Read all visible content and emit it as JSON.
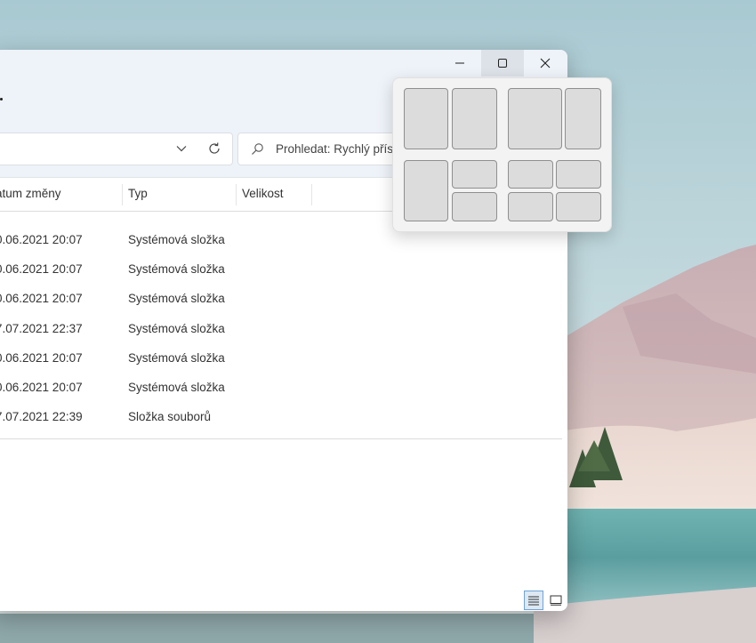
{
  "window": {
    "caption_buttons": {
      "minimize_icon": "minimize-icon",
      "maximize_icon": "maximize-icon",
      "close_icon": "close-icon"
    }
  },
  "toolbar": {
    "address_icons": [
      "chevron-down-icon",
      "refresh-icon"
    ],
    "search_placeholder": "Prohledat: Rychlý přístup"
  },
  "columns": {
    "date_modified": "atum změny",
    "type": "Typ",
    "size": "Velikost"
  },
  "rows": [
    {
      "date": "0.06.2021 20:07",
      "type": "Systémová složka"
    },
    {
      "date": "0.06.2021 20:07",
      "type": "Systémová složka"
    },
    {
      "date": "0.06.2021 20:07",
      "type": "Systémová složka"
    },
    {
      "date": "7.07.2021 22:37",
      "type": "Systémová složka"
    },
    {
      "date": "0.06.2021 20:07",
      "type": "Systémová složka"
    },
    {
      "date": "0.06.2021 20:07",
      "type": "Systémová složka"
    },
    {
      "date": "7.07.2021 22:39",
      "type": "Složka souborů"
    }
  ],
  "status_bar": {
    "view_buttons": [
      "details-view-icon",
      "tiles-view-icon"
    ],
    "active_view": "details"
  },
  "snap_layouts": [
    {
      "name": "two-equal-columns",
      "zones": 2
    },
    {
      "name": "wide-left-narrow-right",
      "zones": 2
    },
    {
      "name": "left-column-two-right-stacked",
      "zones": 3
    },
    {
      "name": "four-quadrants",
      "zones": 4
    }
  ],
  "colors": {
    "accent": "#6fa3d6",
    "titlebar": "#eef3f9",
    "snap_zone": "#dcdcdc"
  }
}
